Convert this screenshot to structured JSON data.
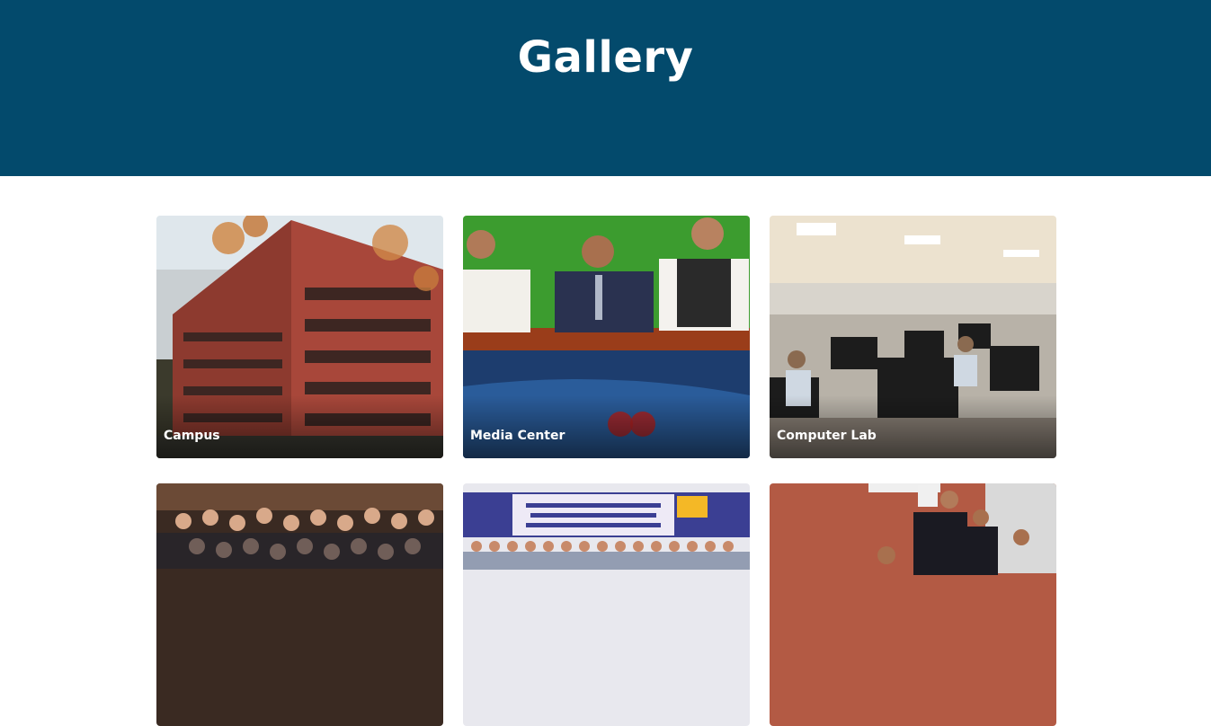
{
  "page": {
    "title": "Gallery"
  },
  "gallery": {
    "items": [
      {
        "label": "Campus"
      },
      {
        "label": "Media Center"
      },
      {
        "label": "Computer Lab"
      },
      {
        "label": ""
      },
      {
        "label": ""
      },
      {
        "label": ""
      }
    ]
  },
  "colors": {
    "header_bg": "#034a6c",
    "title_text": "#ffffff",
    "page_bg": "#ffffff"
  }
}
